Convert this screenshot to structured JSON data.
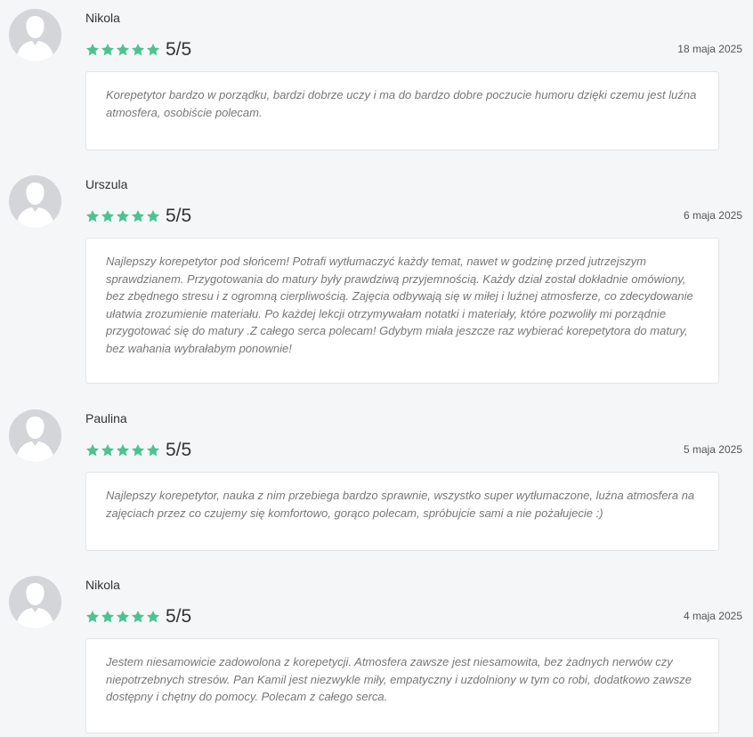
{
  "colors": {
    "star": "#4dc294",
    "avatar_bg": "#d3d5d8",
    "avatar_fg": "#ffffff"
  },
  "icons": {
    "avatar": "user-silhouette-icon",
    "star": "star-icon"
  },
  "reviews": [
    {
      "name": "Nikola",
      "rating": 5,
      "score": "5/5",
      "date": "18 maja 2025",
      "comment": "Korepetytor bardzo w porządku, bardzi dobrze uczy i ma do bardzo dobre poczucie humoru dzięki czemu jest luźna atmosfera, osobiście polecam."
    },
    {
      "name": "Urszula",
      "rating": 5,
      "score": "5/5",
      "date": "6 maja 2025",
      "comment": "Najlepszy korepetytor pod słońcem! Potrafi wytłumaczyć każdy temat, nawet w godzinę przed jutrzejszym sprawdzianem. Przygotowania do matury były prawdziwą przyjemnością. Każdy dział został dokładnie omówiony, bez zbędnego stresu i z ogromną cierpliwością. Zajęcia odbywają się w miłej i luźnej atmosferze, co zdecydowanie ułatwia zrozumienie materiału. Po każdej lekcji otrzymywałam notatki i materiały, które pozwoliły mi porządnie przygotować się do matury .Z całego serca polecam! Gdybym miała jeszcze raz wybierać korepetytora do matury, bez wahania wybrałabym ponownie!"
    },
    {
      "name": "Paulina",
      "rating": 5,
      "score": "5/5",
      "date": "5 maja 2025",
      "comment": "Najlepszy korepetytor, nauka z nim przebiega bardzo sprawnie, wszystko super wytłumaczone, luźna atmosfera na zajęciach przez co czujemy się komfortowo, gorąco polecam, spróbujcie sami a nie pożałujecie :)"
    },
    {
      "name": "Nikola",
      "rating": 5,
      "score": "5/5",
      "date": "4 maja 2025",
      "comment": "Jestem niesamowicie zadowolona z korepetycji. Atmosfera zawsze jest niesamowita, bez żadnych nerwów czy niepotrzebnych stresów. Pan Kamil jest niezwykle miły, empatyczny i uzdolniony w tym co robi, dodatkowo zawsze dostępny i chętny do pomocy. Polecam z całego serca."
    }
  ]
}
